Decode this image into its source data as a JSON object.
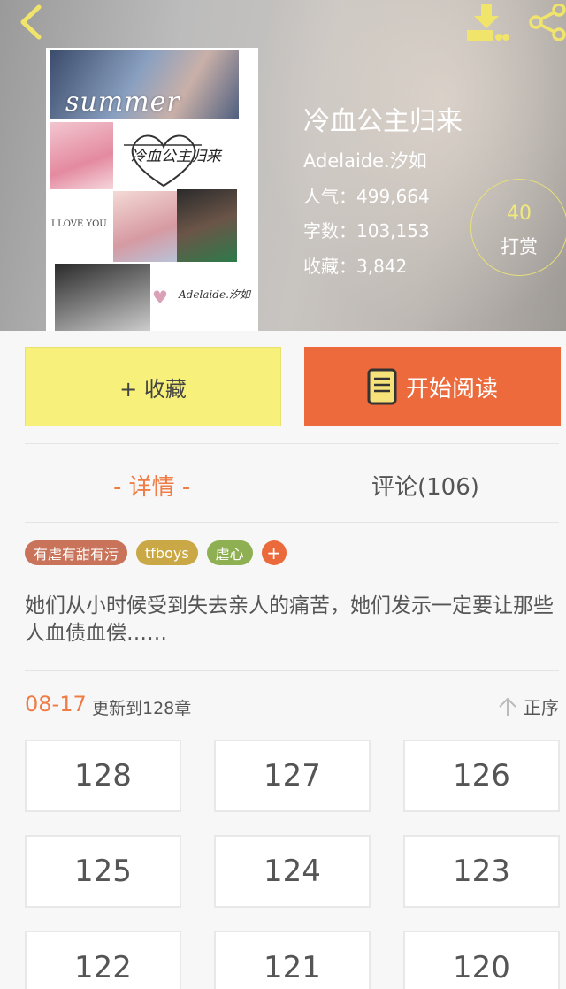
{
  "header": {
    "back_icon": "chevron-left-icon",
    "download_icon": "download-icon",
    "share_icon": "share-icon",
    "accent_color": "#f1e46a"
  },
  "cover": {
    "overlay_text": "summer",
    "title_text": "冷血公主归来",
    "love_text": "I LOVE YOU",
    "signature_text": "Adelaide.汐如"
  },
  "book": {
    "title": "冷血公主归来",
    "author": "Adelaide.汐如",
    "popularity": "人气：499,664",
    "word_count": "字数：103,153",
    "favorites": "收藏：3,842"
  },
  "reward": {
    "count": "40",
    "label": "打赏"
  },
  "actions": {
    "favorite_label": "+ 收藏",
    "read_label": "开始阅读",
    "favorite_color": "#f7f07a",
    "read_color": "#ec6a3c"
  },
  "tabs": {
    "detail": "- 详情 -",
    "comments": "评论(106)"
  },
  "tags": [
    {
      "label": "有虐有甜有污",
      "color": "#c9745a"
    },
    {
      "label": "tfboys",
      "color": "#c9a845"
    },
    {
      "label": "虐心",
      "color": "#8fb052"
    }
  ],
  "tag_add_label": "+",
  "summary": "她们从小时候受到失去亲人的痛苦，她们发示一定要让那些人血债血偿……",
  "update": {
    "date": "08-17",
    "text": "更新到128章",
    "sort_label": "正序",
    "sort_icon": "arrow-up-icon"
  },
  "chapters": [
    "128",
    "127",
    "126",
    "125",
    "124",
    "123",
    "122",
    "121",
    "120"
  ]
}
